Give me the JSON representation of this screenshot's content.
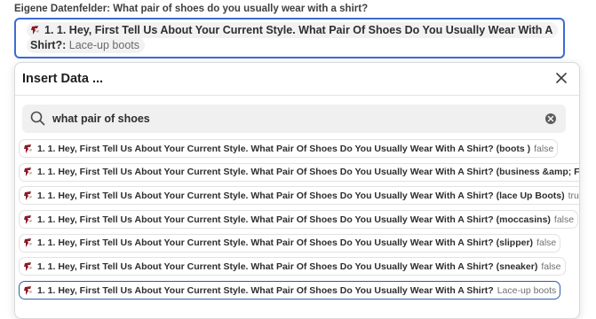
{
  "field": {
    "label": "Eigene Datenfelder: What pair of shoes do you usually wear with a shirt?",
    "pill_text": "1. 1. Hey, First Tell Us About Your Current Style. What Pair Of Shoes Do You Usually Wear With A Shirt?:",
    "pill_value": "Lace-up boots"
  },
  "panel": {
    "title": "Insert Data ...",
    "close_icon": "close-icon"
  },
  "search": {
    "value": "what pair of shoes",
    "icons": [
      "search-icon",
      "clear-icon"
    ]
  },
  "results": [
    {
      "label": "1. 1. Hey, First Tell Us About Your Current Style. What Pair Of Shoes Do You Usually Wear With A Shirt? (boots )",
      "value": "false"
    },
    {
      "label": "1. 1. Hey, First Tell Us About Your Current Style. What Pair Of Shoes Do You Usually Wear With A Shirt? (business &amp; Formal Sh",
      "value": ""
    },
    {
      "label": "1. 1. Hey, First Tell Us About Your Current Style. What Pair Of Shoes Do You Usually Wear With A Shirt? (lace Up Boots)",
      "value": "true"
    },
    {
      "label": "1. 1. Hey, First Tell Us About Your Current Style. What Pair Of Shoes Do You Usually Wear With A Shirt? (moccasins)",
      "value": "false"
    },
    {
      "label": "1. 1. Hey, First Tell Us About Your Current Style. What Pair Of Shoes Do You Usually Wear With A Shirt? (slipper)",
      "value": "false"
    },
    {
      "label": "1. 1. Hey, First Tell Us About Your Current Style. What Pair Of Shoes Do You Usually Wear With A Shirt? (sneaker)",
      "value": "false"
    },
    {
      "label": "1. 1. Hey, First Tell Us About Your Current Style. What Pair Of Shoes Do You Usually Wear With A Shirt?",
      "value": "Lace-up boots"
    }
  ],
  "colors": {
    "field_border": "#3d6bd4",
    "selected_border": "#2f5fa8",
    "app_icon": "#8a1a24"
  }
}
